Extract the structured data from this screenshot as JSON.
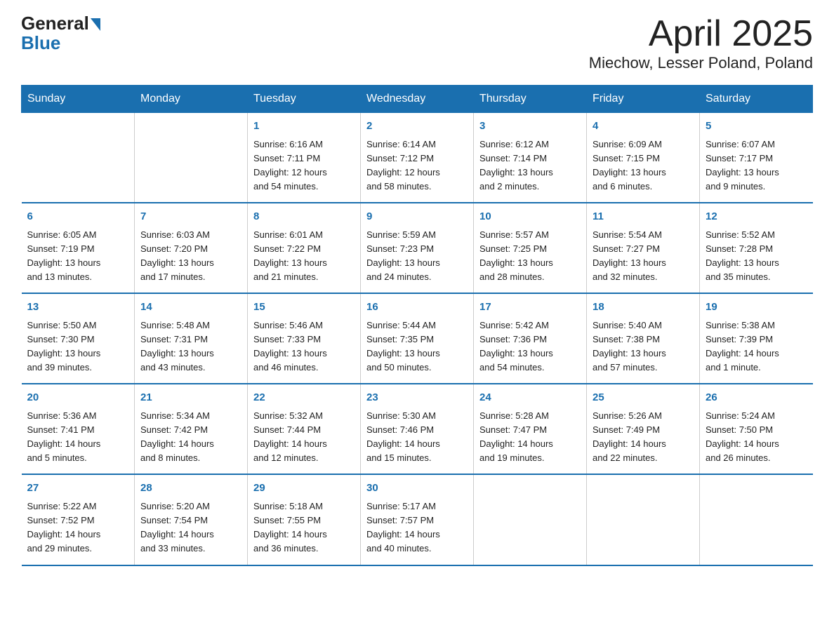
{
  "header": {
    "logo_general": "General",
    "logo_blue": "Blue",
    "title": "April 2025",
    "subtitle": "Miechow, Lesser Poland, Poland"
  },
  "days_of_week": [
    "Sunday",
    "Monday",
    "Tuesday",
    "Wednesday",
    "Thursday",
    "Friday",
    "Saturday"
  ],
  "weeks": [
    [
      {
        "num": "",
        "info": ""
      },
      {
        "num": "",
        "info": ""
      },
      {
        "num": "1",
        "info": "Sunrise: 6:16 AM\nSunset: 7:11 PM\nDaylight: 12 hours\nand 54 minutes."
      },
      {
        "num": "2",
        "info": "Sunrise: 6:14 AM\nSunset: 7:12 PM\nDaylight: 12 hours\nand 58 minutes."
      },
      {
        "num": "3",
        "info": "Sunrise: 6:12 AM\nSunset: 7:14 PM\nDaylight: 13 hours\nand 2 minutes."
      },
      {
        "num": "4",
        "info": "Sunrise: 6:09 AM\nSunset: 7:15 PM\nDaylight: 13 hours\nand 6 minutes."
      },
      {
        "num": "5",
        "info": "Sunrise: 6:07 AM\nSunset: 7:17 PM\nDaylight: 13 hours\nand 9 minutes."
      }
    ],
    [
      {
        "num": "6",
        "info": "Sunrise: 6:05 AM\nSunset: 7:19 PM\nDaylight: 13 hours\nand 13 minutes."
      },
      {
        "num": "7",
        "info": "Sunrise: 6:03 AM\nSunset: 7:20 PM\nDaylight: 13 hours\nand 17 minutes."
      },
      {
        "num": "8",
        "info": "Sunrise: 6:01 AM\nSunset: 7:22 PM\nDaylight: 13 hours\nand 21 minutes."
      },
      {
        "num": "9",
        "info": "Sunrise: 5:59 AM\nSunset: 7:23 PM\nDaylight: 13 hours\nand 24 minutes."
      },
      {
        "num": "10",
        "info": "Sunrise: 5:57 AM\nSunset: 7:25 PM\nDaylight: 13 hours\nand 28 minutes."
      },
      {
        "num": "11",
        "info": "Sunrise: 5:54 AM\nSunset: 7:27 PM\nDaylight: 13 hours\nand 32 minutes."
      },
      {
        "num": "12",
        "info": "Sunrise: 5:52 AM\nSunset: 7:28 PM\nDaylight: 13 hours\nand 35 minutes."
      }
    ],
    [
      {
        "num": "13",
        "info": "Sunrise: 5:50 AM\nSunset: 7:30 PM\nDaylight: 13 hours\nand 39 minutes."
      },
      {
        "num": "14",
        "info": "Sunrise: 5:48 AM\nSunset: 7:31 PM\nDaylight: 13 hours\nand 43 minutes."
      },
      {
        "num": "15",
        "info": "Sunrise: 5:46 AM\nSunset: 7:33 PM\nDaylight: 13 hours\nand 46 minutes."
      },
      {
        "num": "16",
        "info": "Sunrise: 5:44 AM\nSunset: 7:35 PM\nDaylight: 13 hours\nand 50 minutes."
      },
      {
        "num": "17",
        "info": "Sunrise: 5:42 AM\nSunset: 7:36 PM\nDaylight: 13 hours\nand 54 minutes."
      },
      {
        "num": "18",
        "info": "Sunrise: 5:40 AM\nSunset: 7:38 PM\nDaylight: 13 hours\nand 57 minutes."
      },
      {
        "num": "19",
        "info": "Sunrise: 5:38 AM\nSunset: 7:39 PM\nDaylight: 14 hours\nand 1 minute."
      }
    ],
    [
      {
        "num": "20",
        "info": "Sunrise: 5:36 AM\nSunset: 7:41 PM\nDaylight: 14 hours\nand 5 minutes."
      },
      {
        "num": "21",
        "info": "Sunrise: 5:34 AM\nSunset: 7:42 PM\nDaylight: 14 hours\nand 8 minutes."
      },
      {
        "num": "22",
        "info": "Sunrise: 5:32 AM\nSunset: 7:44 PM\nDaylight: 14 hours\nand 12 minutes."
      },
      {
        "num": "23",
        "info": "Sunrise: 5:30 AM\nSunset: 7:46 PM\nDaylight: 14 hours\nand 15 minutes."
      },
      {
        "num": "24",
        "info": "Sunrise: 5:28 AM\nSunset: 7:47 PM\nDaylight: 14 hours\nand 19 minutes."
      },
      {
        "num": "25",
        "info": "Sunrise: 5:26 AM\nSunset: 7:49 PM\nDaylight: 14 hours\nand 22 minutes."
      },
      {
        "num": "26",
        "info": "Sunrise: 5:24 AM\nSunset: 7:50 PM\nDaylight: 14 hours\nand 26 minutes."
      }
    ],
    [
      {
        "num": "27",
        "info": "Sunrise: 5:22 AM\nSunset: 7:52 PM\nDaylight: 14 hours\nand 29 minutes."
      },
      {
        "num": "28",
        "info": "Sunrise: 5:20 AM\nSunset: 7:54 PM\nDaylight: 14 hours\nand 33 minutes."
      },
      {
        "num": "29",
        "info": "Sunrise: 5:18 AM\nSunset: 7:55 PM\nDaylight: 14 hours\nand 36 minutes."
      },
      {
        "num": "30",
        "info": "Sunrise: 5:17 AM\nSunset: 7:57 PM\nDaylight: 14 hours\nand 40 minutes."
      },
      {
        "num": "",
        "info": ""
      },
      {
        "num": "",
        "info": ""
      },
      {
        "num": "",
        "info": ""
      }
    ]
  ]
}
